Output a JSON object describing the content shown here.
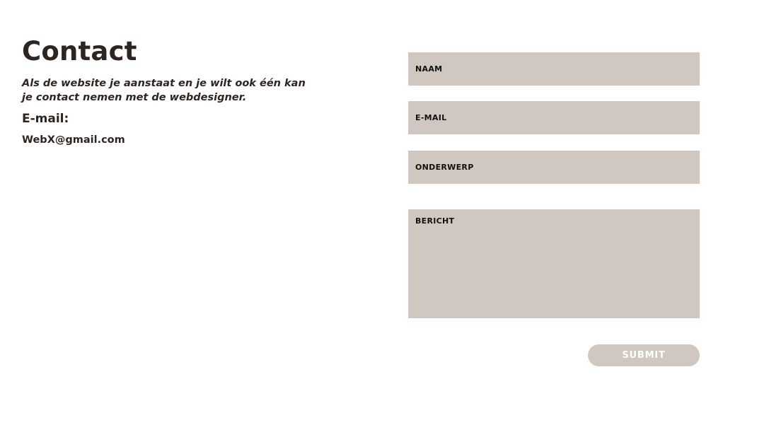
{
  "contact": {
    "title": "Contact",
    "intro": "Als de website je aanstaat en je wilt ook één kan je contact nemen met de webdesigner.",
    "email_heading": "E-mail:",
    "email_value": "WebX@gmail.com"
  },
  "form": {
    "naam_label": "NAAM",
    "email_label": "E-MAIL",
    "onderwerp_label": "ONDERWERP",
    "bericht_label": "BERICHT",
    "submit_label": "SUBMIT"
  },
  "colors": {
    "text": "#2e2520",
    "field_bg": "#d0c7c1",
    "label_text": "#111111",
    "button_text": "#ffffff"
  }
}
